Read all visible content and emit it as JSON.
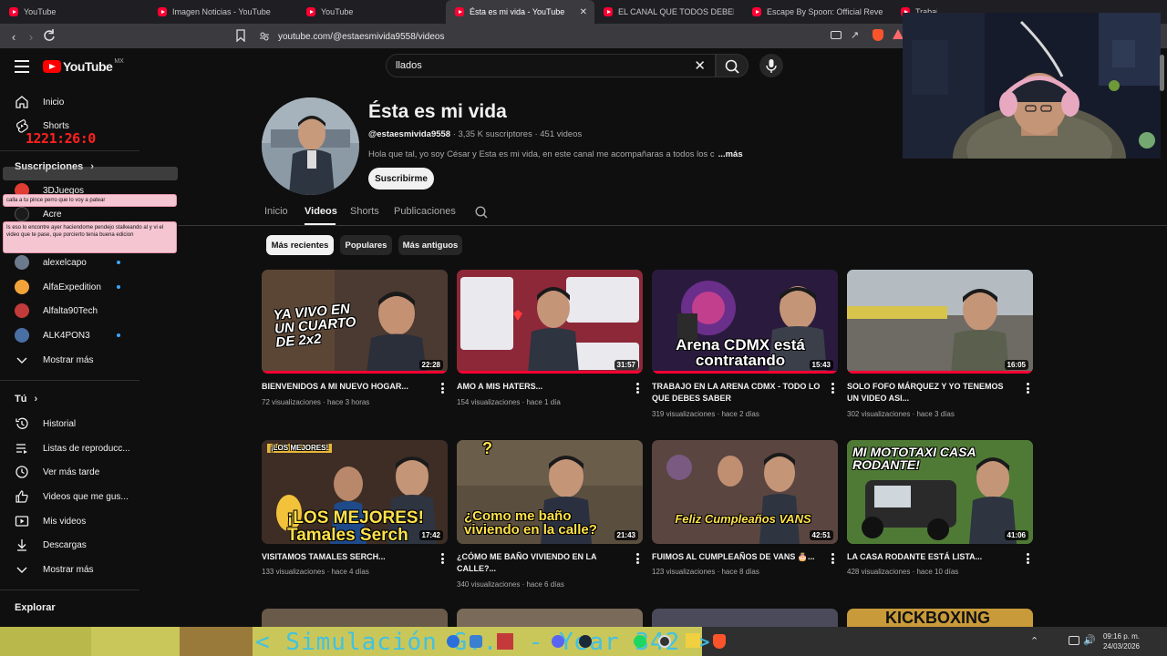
{
  "browser": {
    "tabs": [
      {
        "label": "YouTube"
      },
      {
        "label": "Imagen Noticias - YouTube"
      },
      {
        "label": "YouTube"
      },
      {
        "label": "Ésta es mi vida - YouTube",
        "active": true
      },
      {
        "label": "EL CANAL QUE TODOS DEBERIAMOS..."
      },
      {
        "label": "Escape By Spoon: Official Reveal Trai..."
      },
      {
        "label": "Trabajando Como Vendedor Hasta C..."
      }
    ],
    "url": "youtube.com/@estaesmivida9558/videos"
  },
  "header": {
    "logo_text": "YouTube",
    "region": "MX",
    "search_value": "llados"
  },
  "sidebar": {
    "main_items": [
      {
        "label": "Inicio",
        "icon": "home-icon"
      },
      {
        "label": "Shorts",
        "icon": "shorts-icon"
      }
    ],
    "subs_heading": "Suscripciones",
    "subscriptions": [
      {
        "label": "3DJuegos",
        "dot": false
      },
      {
        "label": "Acre",
        "dot": false
      },
      {
        "label": "alexelcapo",
        "dot": true
      },
      {
        "label": "AlfaExpedition",
        "dot": true
      },
      {
        "label": "Alfalta90Tech",
        "dot": false
      },
      {
        "label": "ALK4PON3",
        "dot": true
      }
    ],
    "show_more": "Mostrar más",
    "you_heading": "Tú",
    "you_items": [
      {
        "label": "Historial",
        "icon": "history-icon"
      },
      {
        "label": "Listas de reproducc...",
        "icon": "playlist-icon"
      },
      {
        "label": "Ver más tarde",
        "icon": "clock-icon"
      },
      {
        "label": "Videos que me gus...",
        "icon": "thumbs-up-icon"
      },
      {
        "label": "Mis videos",
        "icon": "my-videos-icon"
      },
      {
        "label": "Descargas",
        "icon": "download-icon"
      },
      {
        "label": "Mostrar más",
        "icon": "chevron-down-icon"
      }
    ],
    "explore_heading": "Explorar"
  },
  "overlay": {
    "timer": "1221:26:0",
    "chat": [
      "calla a tu pince perro que lo voy a patear",
      "Is eso lo encontre ayer haciendome pendejo stalkeando al y vi el video que te pase, que porcierto tenia buena edicion"
    ]
  },
  "channel": {
    "name": "Ésta es mi vida",
    "handle": "@estaesmivida9558",
    "stats": " · 3,35 K suscriptores · 451 videos",
    "description": "Hola que tal, yo soy César y Esta es mi vida, en este canal me acompañaras a todos los c",
    "more": "...más",
    "subscribe": "Suscribirme",
    "tabs": [
      "Inicio",
      "Videos",
      "Shorts",
      "Publicaciones"
    ],
    "active_tab": "Videos"
  },
  "chips": [
    "Más recientes",
    "Populares",
    "Más antiguos"
  ],
  "videos": [
    {
      "title": "BIENVENIDOS A MI NUEVO HOGAR...",
      "views": "72 visualizaciones",
      "age": "hace 3 horas",
      "duration": "22:28",
      "thumb_text": "YA VIVO EN UN CUARTO DE 2x2",
      "watched": 1.0
    },
    {
      "title": "AMO A MIS HATERS...",
      "views": "154 visualizaciones",
      "age": "hace 1 día",
      "duration": "31:57",
      "thumb_text": "",
      "watched": 1.0
    },
    {
      "title": "TRABAJO EN LA ARENA CDMX - TODO LO QUE DEBES SABER",
      "views": "319 visualizaciones",
      "age": "hace 2 días",
      "duration": "15:43",
      "thumb_text": "Arena CDMX está contratando",
      "watched": 1.0
    },
    {
      "title": "SOLO FOFO MÁRQUEZ Y YO TENEMOS UN VIDEO ASI...",
      "views": "302 visualizaciones",
      "age": "hace 3 días",
      "duration": "16:05",
      "thumb_text": "",
      "watched": 1.0
    },
    {
      "title": "VISITAMOS TAMALES SERCH...",
      "views": "133 visualizaciones",
      "age": "hace 4 días",
      "duration": "17:42",
      "thumb_text": "¡LOS MEJORES! Tamales Serch",
      "watched": 0
    },
    {
      "title": "¿CÓMO ME BAÑO VIVIENDO EN LA CALLE?...",
      "views": "340 visualizaciones",
      "age": "hace 6 días",
      "duration": "21:43",
      "thumb_text": "¿Como me baño viviendo en la calle?",
      "watched": 0
    },
    {
      "title": "FUIMOS AL CUMPLEAÑOS DE VANS 🎂...",
      "views": "123 visualizaciones",
      "age": "hace 8 días",
      "duration": "42:51",
      "thumb_text": "Feliz Cumpleaños VANS",
      "watched": 0
    },
    {
      "title": "LA CASA RODANTE ESTÁ LISTA...",
      "views": "428 visualizaciones",
      "age": "hace 10 días",
      "duration": "41:06",
      "thumb_text": "MI MOTOTAXI CASA RODANTE!",
      "watched": 0
    }
  ],
  "taskbar": {
    "ticker": "< Simulación G... - Year 342 >",
    "time": "09:16 p. m.",
    "date": "24/03/2026"
  }
}
